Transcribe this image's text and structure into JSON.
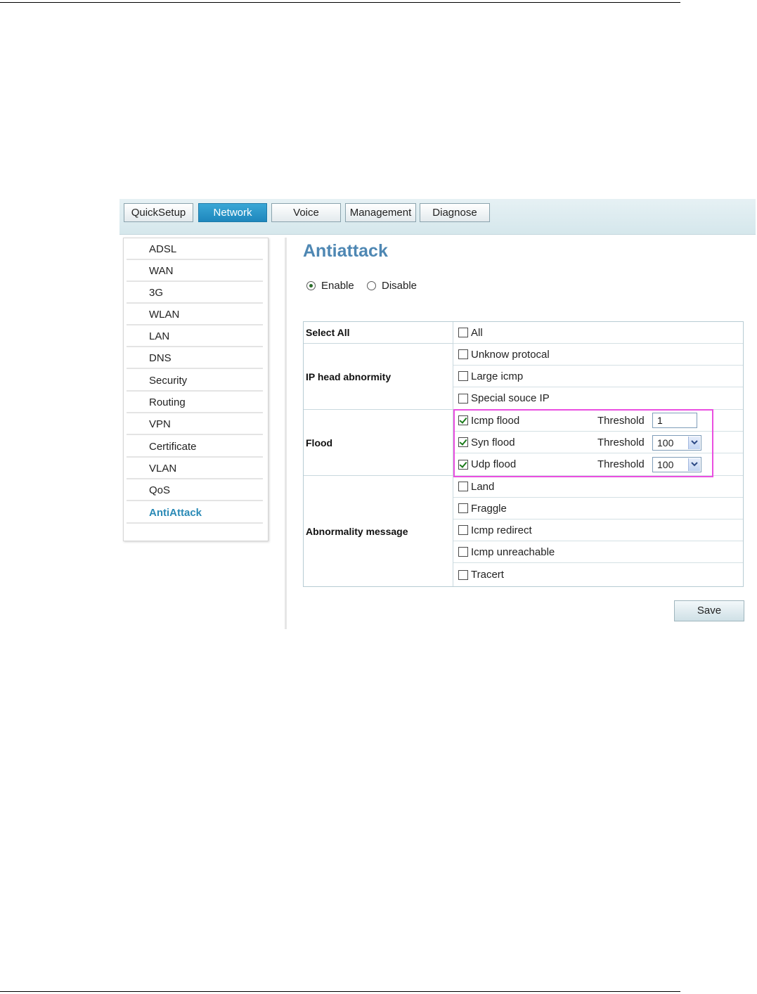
{
  "nav": {
    "tabs": [
      {
        "label": "QuickSetup"
      },
      {
        "label": "Network"
      },
      {
        "label": "Voice"
      },
      {
        "label": "Management"
      },
      {
        "label": "Diagnose"
      }
    ],
    "active_tab": "Network",
    "active_color": "#2596cb"
  },
  "sidebar": {
    "items": [
      {
        "label": "ADSL"
      },
      {
        "label": "WAN"
      },
      {
        "label": "3G"
      },
      {
        "label": "WLAN"
      },
      {
        "label": "LAN"
      },
      {
        "label": "DNS"
      },
      {
        "label": "Security"
      },
      {
        "label": "Routing"
      },
      {
        "label": "VPN"
      },
      {
        "label": "Certificate"
      },
      {
        "label": "VLAN"
      },
      {
        "label": "QoS"
      },
      {
        "label": "AntiAttack"
      }
    ],
    "active_item": "AntiAttack"
  },
  "page": {
    "title": "Antiattack",
    "mode": {
      "enable_label": "Enable",
      "disable_label": "Disable",
      "selected": "Enable"
    }
  },
  "table": {
    "select_all": {
      "label": "Select All",
      "option": "All",
      "checked": false
    },
    "ip_head": {
      "label": "IP head abnormity",
      "options": [
        {
          "label": "Unknow protocal",
          "checked": false
        },
        {
          "label": "Large icmp",
          "checked": false
        },
        {
          "label": "Special souce IP",
          "checked": false
        }
      ]
    },
    "flood": {
      "label": "Flood",
      "threshold_label": "Threshold",
      "options": [
        {
          "label": "Icmp flood",
          "checked": true,
          "threshold": "1",
          "control": "text"
        },
        {
          "label": "Syn flood",
          "checked": true,
          "threshold": "100",
          "control": "select"
        },
        {
          "label": "Udp flood",
          "checked": true,
          "threshold": "100",
          "control": "select"
        }
      ]
    },
    "abnormality": {
      "label": "Abnormality message",
      "options": [
        {
          "label": "Land",
          "checked": false
        },
        {
          "label": "Fraggle",
          "checked": false
        },
        {
          "label": "Icmp redirect",
          "checked": false
        },
        {
          "label": "Icmp unreachable",
          "checked": false
        },
        {
          "label": "Tracert",
          "checked": false
        }
      ]
    }
  },
  "buttons": {
    "save_label": "Save"
  },
  "colors": {
    "title": "#4e87b3",
    "highlight_box": "#ea4fe0",
    "active_sidebar": "#2a8ab6"
  }
}
